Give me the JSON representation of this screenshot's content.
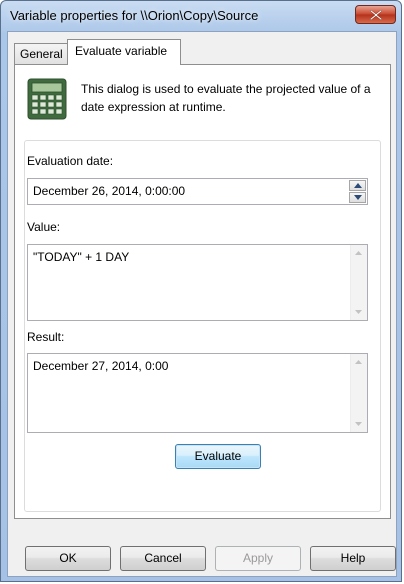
{
  "window": {
    "title": "Variable properties for \\\\Orion\\Copy\\Source"
  },
  "tabs": [
    {
      "label": "General"
    },
    {
      "label": "Evaluate variable"
    }
  ],
  "intro": {
    "text": "This dialog is used to evaluate the projected value of a date expression at runtime."
  },
  "evaluation_date": {
    "label": "Evaluation date:",
    "value": "December 26, 2014,  0:00:00"
  },
  "value_field": {
    "label": "Value:",
    "value": "\"TODAY\" +  1 DAY"
  },
  "result_field": {
    "label": "Result:",
    "value": "December 27, 2014,  0:00"
  },
  "evaluate_button": {
    "label": "Evaluate"
  },
  "footer": {
    "ok": "OK",
    "cancel": "Cancel",
    "apply": "Apply",
    "help": "Help"
  },
  "icons": {
    "title_close": "close-icon",
    "intro": "calculator-icon",
    "spin_up": "chevron-up-icon",
    "spin_down": "chevron-down-icon"
  },
  "colors": {
    "title_bar": "#aac6e8",
    "close_button": "#c7442c",
    "evaluate_border": "#3c7fb1"
  }
}
